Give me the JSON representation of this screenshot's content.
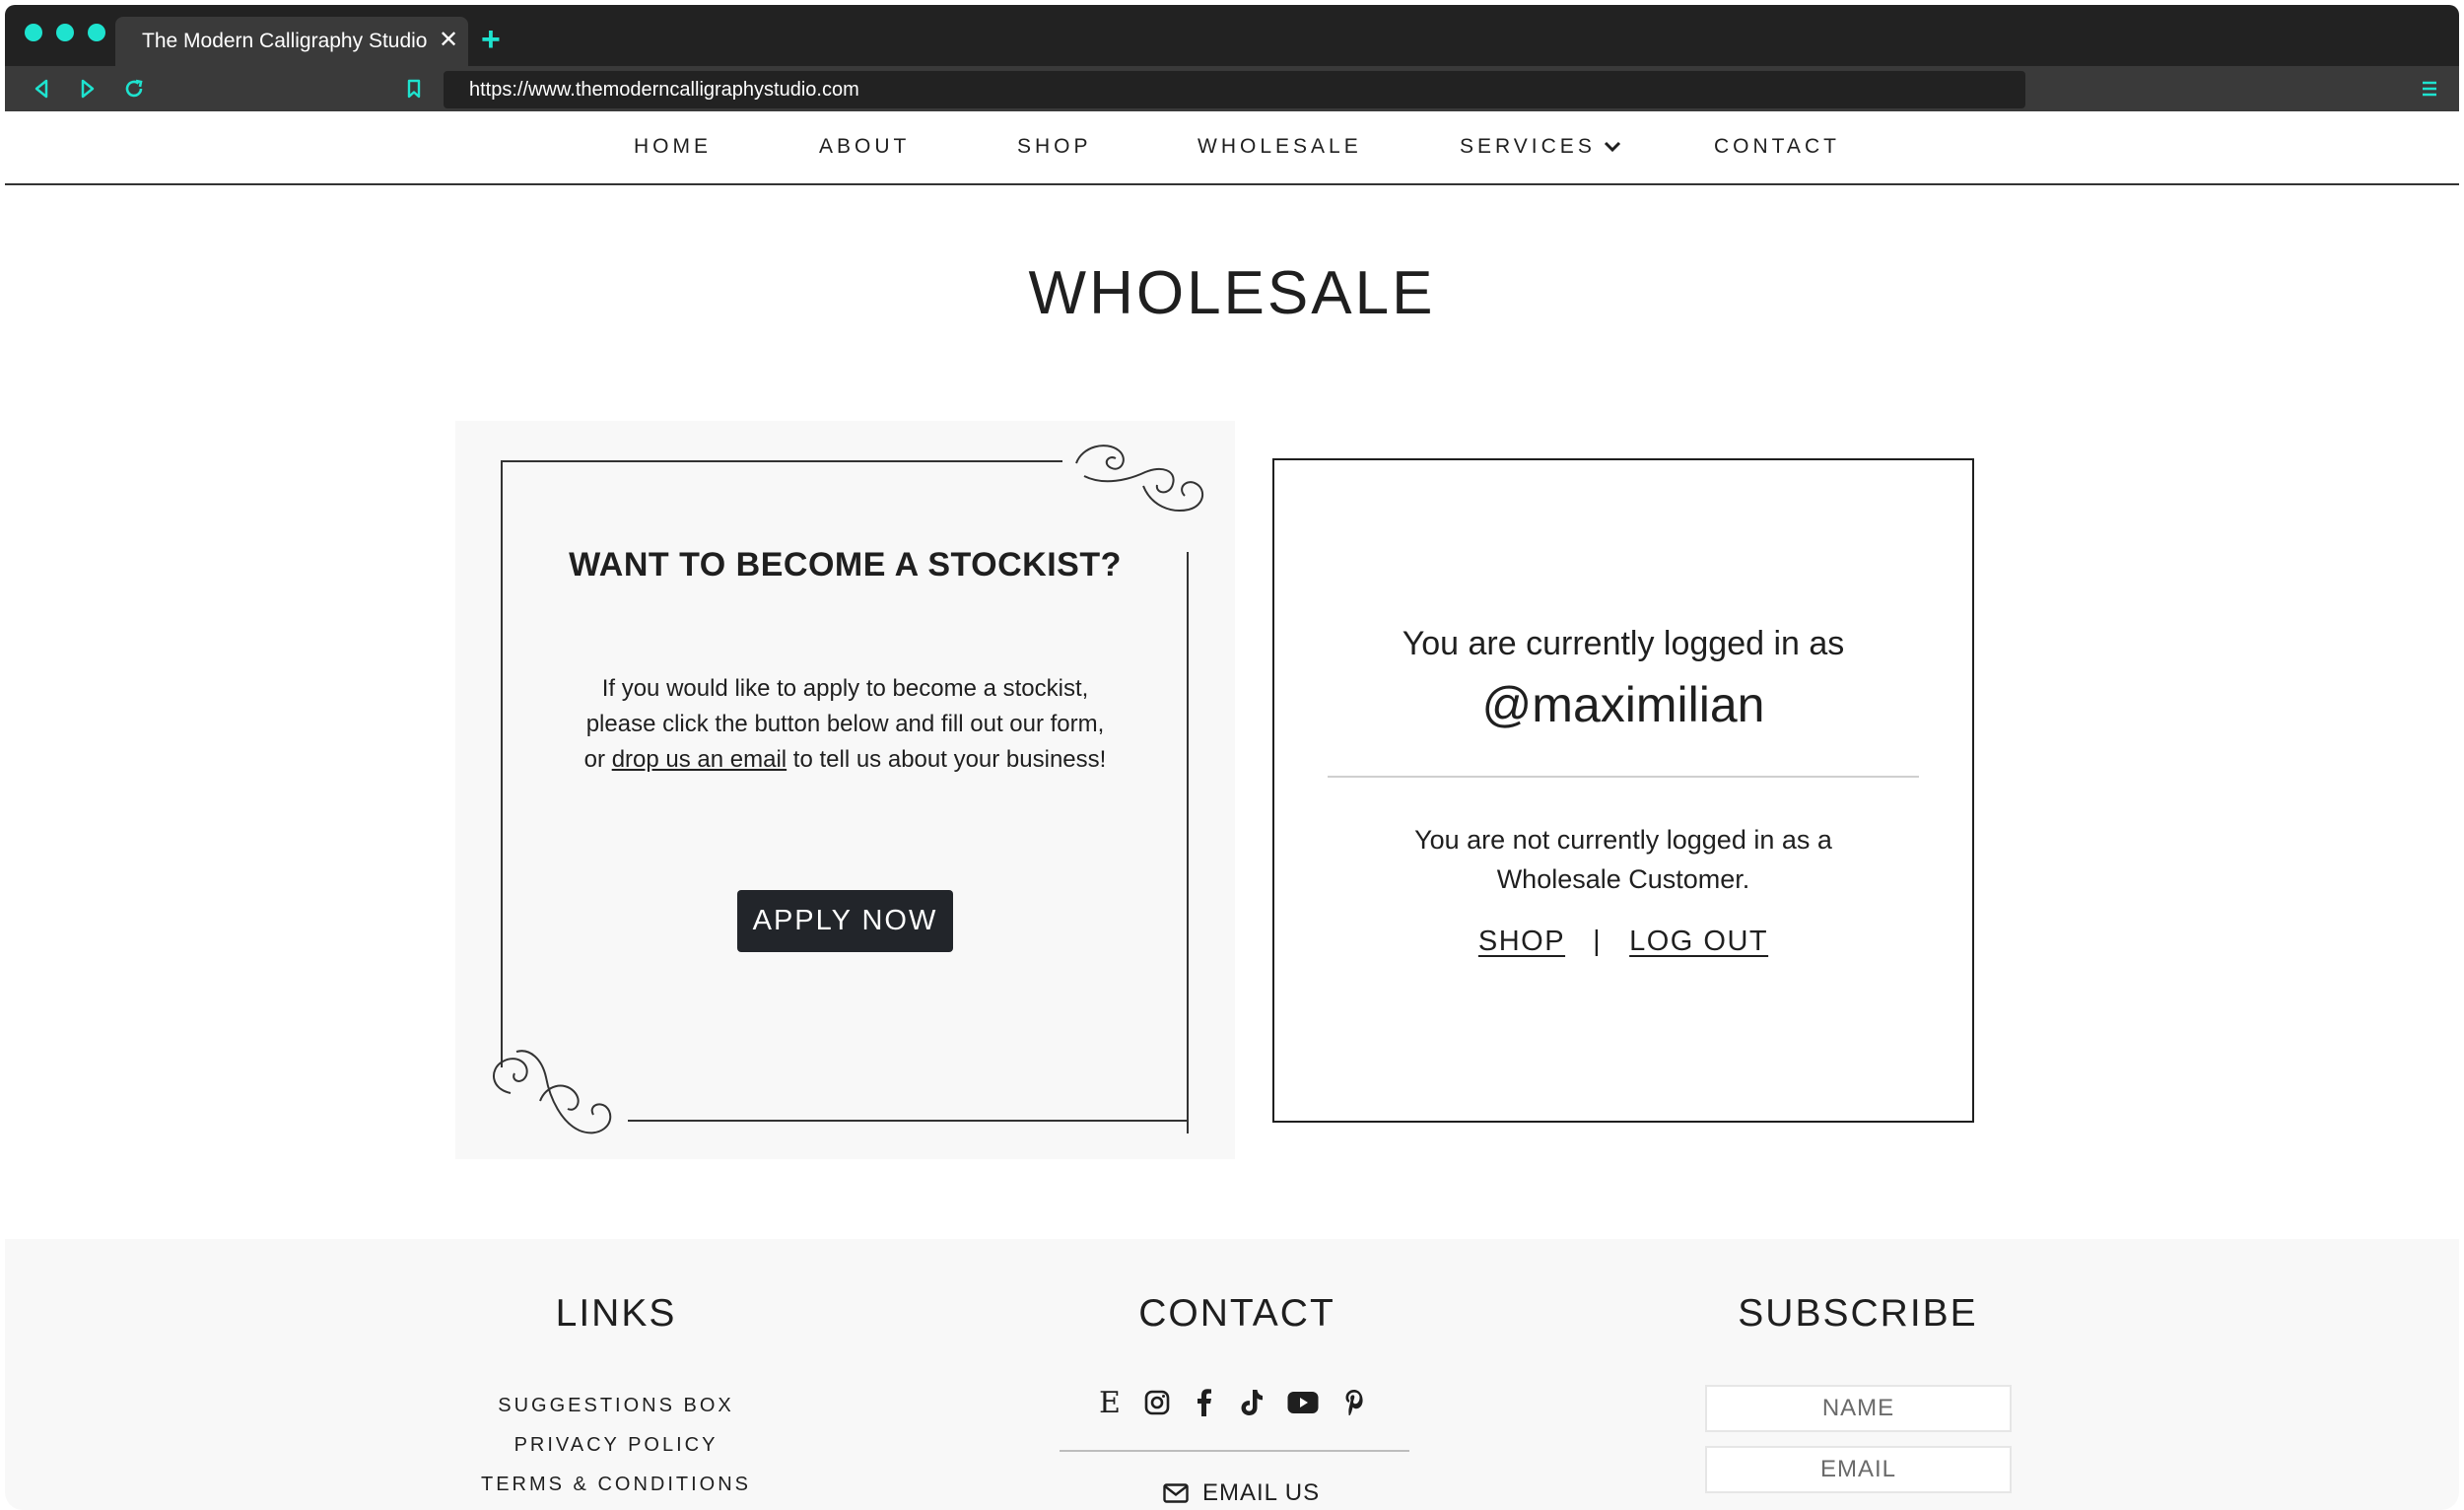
{
  "browser": {
    "tab_title": "The Modern Calligraphy Studio",
    "tab_close": "✕",
    "new_tab": "+",
    "url": "https://www.themoderncalligraphystudio.com",
    "accent_color": "#1ee3cf"
  },
  "nav": {
    "items": [
      "HOME",
      "ABOUT",
      "SHOP",
      "WHOLESALE",
      "SERVICES",
      "CONTACT"
    ]
  },
  "page": {
    "title": "WHOLESALE"
  },
  "stockist": {
    "title": "WANT TO BECOME A STOCKIST?",
    "text_before": "If you would like to apply to become a stockist, please click the button below and fill out our form, or ",
    "link": "drop us an email",
    "text_after": " to tell us about your business!",
    "button": "APPLY NOW"
  },
  "account": {
    "logged_in_label": "You are currently logged in as",
    "username": "@maximilian",
    "not_wholesale": "You are not currently logged in as a Wholesale Customer.",
    "shop_link": "SHOP",
    "separator": "|",
    "logout_link": "LOG OUT"
  },
  "footer": {
    "links_title": "LINKS",
    "links": [
      "SUGGESTIONS BOX",
      "PRIVACY POLICY",
      "TERMS & CONDITIONS"
    ],
    "contact_title": "CONTACT",
    "social_icons": [
      "etsy-icon",
      "instagram-icon",
      "facebook-icon",
      "tiktok-icon",
      "youtube-icon",
      "pinterest-icon"
    ],
    "etsy_glyph": "E",
    "email_label": "EMAIL US",
    "subscribe_title": "SUBSCRIBE",
    "name_placeholder": "NAME",
    "email_placeholder": "EMAIL"
  }
}
